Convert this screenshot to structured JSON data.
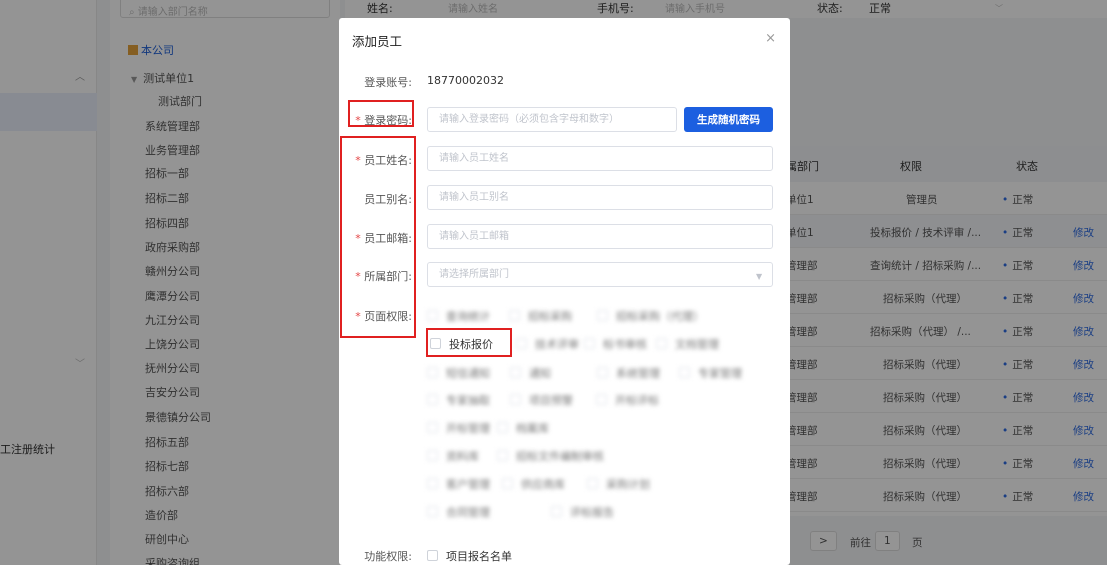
{
  "sidebar": {
    "menu_partial": "工注册统计"
  },
  "tree": {
    "search_placeholder": "请输入部门名称",
    "root": "本公司",
    "items": [
      "测试单位1",
      "测试部门",
      "系统管理部",
      "业务管理部",
      "招标一部",
      "招标二部",
      "招标四部",
      "政府采购部",
      "赣州分公司",
      "鹰潭分公司",
      "九江分公司",
      "上饶分公司",
      "抚州分公司",
      "吉安分公司",
      "景德镇分公司",
      "招标五部",
      "招标七部",
      "招标六部",
      "造价部",
      "研创中心",
      "采购咨询组"
    ]
  },
  "filters": {
    "name_label": "姓名:",
    "name_placeholder": "请输入姓名",
    "phone_label": "手机号:",
    "phone_placeholder": "请输入手机号",
    "status_label": "状态:",
    "status_value": "正常"
  },
  "table": {
    "headers": [
      "属部门",
      "权限",
      "状态"
    ],
    "rows": [
      {
        "dept": "单位1",
        "perm": "管理员",
        "status": "正常",
        "op": ""
      },
      {
        "dept": "单位1",
        "perm": "投标报价 / 技术评审 /...",
        "status": "正常",
        "op": "修改"
      },
      {
        "dept": "管理部",
        "perm": "查询统计 / 招标采购 /...",
        "status": "正常",
        "op": "修改"
      },
      {
        "dept": "管理部",
        "perm": "招标采购（代理）",
        "status": "正常",
        "op": "修改"
      },
      {
        "dept": "管理部",
        "perm": "招标采购（代理） /...",
        "status": "正常",
        "op": "修改"
      },
      {
        "dept": "管理部",
        "perm": "招标采购（代理）",
        "status": "正常",
        "op": "修改"
      },
      {
        "dept": "管理部",
        "perm": "招标采购（代理）",
        "status": "正常",
        "op": "修改"
      },
      {
        "dept": "管理部",
        "perm": "招标采购（代理）",
        "status": "正常",
        "op": "修改"
      },
      {
        "dept": "管理部",
        "perm": "招标采购（代理）",
        "status": "正常",
        "op": "修改"
      },
      {
        "dept": "管理部",
        "perm": "招标采购（代理）",
        "status": "正常",
        "op": "修改"
      }
    ],
    "pager": {
      "next": ">",
      "goto_label": "前往",
      "page": "1",
      "page_suffix": "页"
    }
  },
  "dialog": {
    "title": "添加员工",
    "close_glyph": "×",
    "account_label": "登录账号:",
    "account_value": "18770002032",
    "password_label": "登录密码:",
    "password_placeholder": "请输入登录密码（必须包含字母和数字）",
    "gen_password_button": "生成随机密码",
    "name_label": "员工姓名:",
    "name_placeholder": "请输入员工姓名",
    "alias_label": "员工别名:",
    "alias_placeholder": "请输入员工别名",
    "email_label": "员工邮箱:",
    "email_placeholder": "请输入员工邮箱",
    "dept_label": "所属部门:",
    "dept_placeholder": "请选择所属部门",
    "page_perm_label": "页面权限:",
    "page_perms": {
      "r1": [
        "查询统计",
        "招标采购",
        "招标采购（代理）"
      ],
      "r2": [
        "投标报价",
        "技术评审",
        "标书审核",
        "文档管理"
      ],
      "r3": [
        "短信通知",
        "通知",
        "系统管理",
        "专家管理"
      ],
      "r4": [
        "专家抽取",
        "项目预警",
        "开标评标"
      ],
      "r5": [
        "开标管理",
        "档案库"
      ],
      "r6": [
        "资料库",
        "招标文件编制审核"
      ],
      "r7": [
        "客户管理",
        "供应商库",
        "采购计划"
      ],
      "r8": [
        "合同管理",
        "评标报告"
      ]
    },
    "func_perm_label": "功能权限:",
    "func_perms": [
      "项目报名名单"
    ]
  }
}
